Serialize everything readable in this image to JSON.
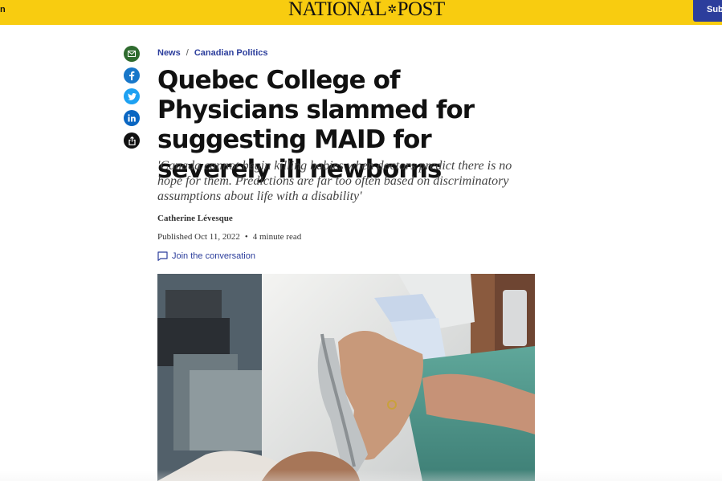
{
  "header": {
    "left_glyph": "n",
    "logo_left": "NATIONAL",
    "logo_right": "POST",
    "subscribe_label": "Sub"
  },
  "share": {
    "icons": [
      "email-icon",
      "facebook-icon",
      "twitter-icon",
      "linkedin-icon",
      "share-icon"
    ],
    "colors": {
      "email": "#2f6b2f",
      "facebook": "#1877c9",
      "twitter": "#1da1f2",
      "linkedin": "#0a66c2",
      "share": "#111111"
    }
  },
  "article": {
    "breadcrumb": {
      "section": "News",
      "separator": "/",
      "subsection": "Canadian Politics"
    },
    "headline": "Quebec College of Physicians slammed for suggesting MAID for severely ill newborns",
    "dek": "'Canada cannot begin killing babies when doctors predict there is no hope for them. Predictions are far too often based on discriminatory assumptions about life with a disability'",
    "author": "Catherine Lévesque",
    "published": "Published Oct 11, 2022",
    "read_time": "4 minute read",
    "join_label": "Join the conversation"
  },
  "colors": {
    "brand_yellow": "#f8cc10",
    "link_blue": "#2c3e9c"
  }
}
